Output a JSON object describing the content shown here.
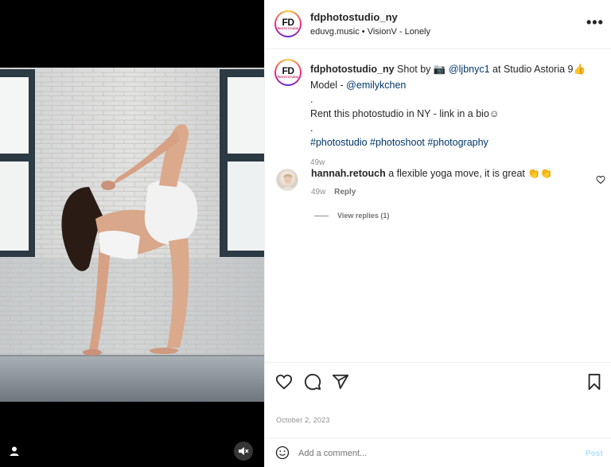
{
  "post": {
    "username": "fdphotostudio_ny",
    "audio": "eduvg.music • VisionV - Lonely",
    "avatar_logo_text": "FD",
    "avatar_logo_sub": "PHOTO STUDIO",
    "more_label": "•••"
  },
  "caption": {
    "username": "fdphotostudio_ny",
    "text_part1": "Shot by 📷",
    "mention1": "@ljbnyc1",
    "text_part2": "at Studio Astoria 9👍",
    "text_model": "Model -",
    "mention2": "@emilykchen",
    "dot1": ".",
    "line_rent": "Rent this photostudio in NY - link in a bio☺",
    "dot2": ".",
    "hashtags": "#photostudio #photoshoot #photography",
    "time": "49w"
  },
  "comment": {
    "username": "hannah.retouch",
    "text": "a flexible yoga move, it is great 👏👏",
    "time": "49w",
    "reply_label": "Reply",
    "view_replies": "View replies (1)"
  },
  "actions": {
    "date": "October 2, 2023",
    "like_icon": "heart-icon",
    "comment_icon": "comment-icon",
    "share_icon": "share-icon",
    "save_icon": "bookmark-icon"
  },
  "add_comment": {
    "placeholder": "Add a comment...",
    "post_label": "Post"
  },
  "colors": {
    "link": "#00376b",
    "meta": "#8e8e8e",
    "post_disabled": "#b2dffc",
    "media_bg": "#000000"
  }
}
